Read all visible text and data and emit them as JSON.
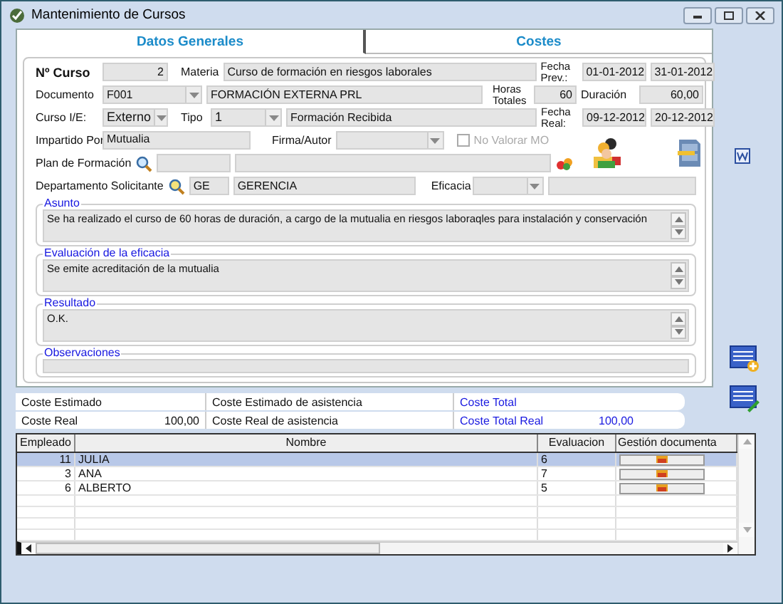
{
  "window": {
    "title": "Mantenimiento de Cursos"
  },
  "tabs": [
    {
      "label": "Datos Generales",
      "selected": true
    },
    {
      "label": "Costes",
      "selected": false
    }
  ],
  "form": {
    "n_curso": {
      "label": "Nº Curso",
      "value": "2"
    },
    "materia": {
      "label": "Materia",
      "value": "Curso de formación en riesgos laborales"
    },
    "fecha_prev": {
      "label": "Fecha Prev.:",
      "start": "01-01-2012",
      "end": "31-01-2012"
    },
    "documento": {
      "label": "Documento",
      "code": "F001",
      "description": "FORMACIÓN EXTERNA PRL"
    },
    "horas_totales": {
      "label": "Horas Totales",
      "value": "60"
    },
    "duracion": {
      "label": "Duración",
      "value": "60,00"
    },
    "curso_ie": {
      "label": "Curso I/E:",
      "value": "Externo"
    },
    "tipo": {
      "label": "Tipo",
      "code": "1",
      "description": "Formación Recibida"
    },
    "fecha_real": {
      "label": "Fecha Real:",
      "start": "09-12-2012",
      "end": "20-12-2012"
    },
    "impartido_por": {
      "label": "Impartido Por",
      "value": "Mutualia"
    },
    "firma_autor": {
      "label": "Firma/Autor"
    },
    "no_valorar_mo": {
      "label": "No Valorar MO",
      "checked": false,
      "disabled": true
    },
    "plan_formacion": {
      "label": "Plan de Formación"
    },
    "departamento": {
      "label": "Departamento Solicitante",
      "code": "GE",
      "description": "GERENCIA"
    },
    "eficacia": {
      "label": "Eficacia"
    }
  },
  "sections": [
    {
      "title": "Asunto",
      "kind": "memo",
      "text": "Se ha realizado el curso de 60 horas de duración, a cargo de la mutualia en riesgos laboraqles para instalación y conservación"
    },
    {
      "title": "Evaluación de la eficacia",
      "kind": "memo",
      "text": "Se emite acreditación de la mutualia"
    },
    {
      "title": "Resultado",
      "kind": "memo",
      "text": "O.K."
    },
    {
      "title": "Observaciones",
      "kind": "line"
    }
  ],
  "costs": [
    {
      "cells": [
        {
          "label": "Coste Estimado",
          "highlight": false
        },
        {
          "label": "Coste Estimado de asistencia",
          "highlight": false
        },
        {
          "label": "Coste Total",
          "highlight": true
        }
      ]
    },
    {
      "cells": [
        {
          "label": "Coste Real",
          "value": "100,00",
          "highlight": false
        },
        {
          "label": "Coste Real de asistencia",
          "highlight": false
        },
        {
          "label": "Coste Total Real",
          "value": "100,00",
          "highlight": true
        }
      ]
    }
  ],
  "grid": {
    "columns": [
      "Empleado",
      "Nombre",
      "Evaluacion",
      "Gestión documenta"
    ],
    "rows": [
      {
        "empleado": "11",
        "nombre": "JULIA",
        "evaluacion": "6",
        "selected": true
      },
      {
        "empleado": "3",
        "nombre": "ANA",
        "evaluacion": "7",
        "selected": false
      },
      {
        "empleado": "6",
        "nombre": "ALBERTO",
        "evaluacion": "5",
        "selected": false
      }
    ]
  }
}
